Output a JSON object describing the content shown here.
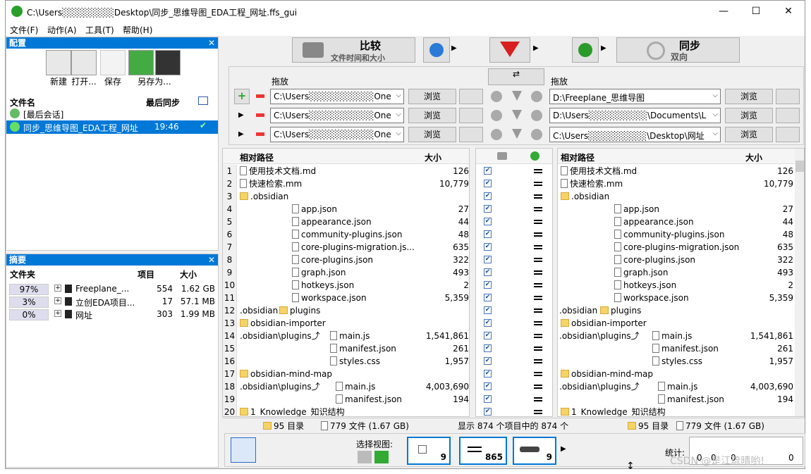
{
  "window": {
    "title": "C:\\Users░░░░░░░░Desktop\\同步_思维导图_EDA工程_网址.ffs_gui"
  },
  "menu": [
    "文件(F)",
    "动作(A)",
    "工具(T)",
    "帮助(H)"
  ],
  "config_panel": {
    "title": "配置",
    "buttons": [
      "新建",
      "打开...",
      "保存",
      "另存为..."
    ],
    "col_file": "文件名",
    "col_last": "最后同步",
    "rows": [
      {
        "name": "[最后会话]",
        "time": ""
      },
      {
        "name": "同步_思维导图_EDA工程_网址",
        "time": "19:46"
      }
    ]
  },
  "summary_panel": {
    "title": "摘要",
    "col_folder": "文件夹",
    "col_items": "项目",
    "col_size": "大小",
    "rows": [
      {
        "pct": "97%",
        "name": "Freeplane_...",
        "items": "554",
        "size": "1.62 GB"
      },
      {
        "pct": "3%",
        "name": "立创EDA项目...",
        "items": "17",
        "size": "57.1 MB"
      },
      {
        "pct": "0%",
        "name": "网址",
        "items": "303",
        "size": "1.99 MB"
      }
    ]
  },
  "toolbar": {
    "compare": "比较",
    "compare_sub": "文件时间和大小",
    "sync": "同步",
    "sync_sub": "双向"
  },
  "left": {
    "drag_label": "拖放",
    "browse": "浏览",
    "paths": [
      "C:\\Users░░░░░░░░░░One",
      "C:\\Users░░░░░░░░░░One",
      "C:\\Users░░░░░░░░░░One"
    ]
  },
  "right": {
    "drag_label": "拖放",
    "browse": "浏览",
    "paths": [
      "D:\\Freeplane_思维导图",
      "D:\\Users░░░░░░░░░\\Documents\\L",
      "C:\\Users░░░░░░░░░\\Desktop\\网址"
    ]
  },
  "grid": {
    "col_path": "相对路径",
    "col_size": "大小",
    "rows": [
      {
        "n": "1",
        "pre": "",
        "ind": 0,
        "type": "file",
        "name": "使用技术文档.md",
        "size": "126",
        "rpre": "",
        "rind": 0
      },
      {
        "n": "2",
        "pre": "",
        "ind": 0,
        "type": "file",
        "name": "快速检索.mm",
        "size": "10,779",
        "rpre": "",
        "rind": 0
      },
      {
        "n": "3",
        "pre": "",
        "ind": 0,
        "type": "folder",
        "name": ".obsidian",
        "size": "",
        "rpre": "",
        "rind": 0
      },
      {
        "n": "4",
        "pre": "",
        "ind": 1,
        "type": "file",
        "name": "app.json",
        "size": "27",
        "rpre": "",
        "rind": 1
      },
      {
        "n": "5",
        "pre": "",
        "ind": 1,
        "type": "file",
        "name": "appearance.json",
        "size": "44",
        "rpre": "",
        "rind": 1
      },
      {
        "n": "6",
        "pre": "",
        "ind": 1,
        "type": "file",
        "name": "community-plugins.json",
        "size": "48",
        "rpre": "",
        "rind": 1
      },
      {
        "n": "7",
        "pre": "",
        "ind": 1,
        "type": "file",
        "name": "core-plugins-migration.js...",
        "rname": "core-plugins-migration.json",
        "size": "635",
        "rpre": "",
        "rind": 1
      },
      {
        "n": "8",
        "pre": "",
        "ind": 1,
        "type": "file",
        "name": "core-plugins.json",
        "size": "322",
        "rpre": "",
        "rind": 1
      },
      {
        "n": "9",
        "pre": "",
        "ind": 1,
        "type": "file",
        "name": "graph.json",
        "size": "493",
        "rpre": "",
        "rind": 1
      },
      {
        "n": "10",
        "pre": "",
        "ind": 1,
        "type": "file",
        "name": "hotkeys.json",
        "size": "2",
        "rpre": "",
        "rind": 1
      },
      {
        "n": "11",
        "pre": "",
        "ind": 1,
        "type": "file",
        "name": "workspace.json",
        "size": "5,359",
        "rpre": "",
        "rind": 1
      },
      {
        "n": "12",
        "pre": ".obsidian",
        "ind": 2,
        "type": "folder",
        "name": "plugins",
        "size": "",
        "rpre": ".obsidian",
        "rind": 2
      },
      {
        "n": "13",
        "pre": "",
        "ind": 0,
        "type": "folder",
        "name": "obsidian-importer",
        "size": "",
        "rpre": "",
        "rind": 0
      },
      {
        "n": "14",
        "pre": ".obsidian\\plugins⤴",
        "ind": 3,
        "type": "file",
        "name": "main.js",
        "size": "1,541,861",
        "rpre": ".obsidian\\plugins⤴",
        "rind": 3
      },
      {
        "n": "15",
        "pre": "",
        "ind": 3,
        "type": "file",
        "name": "manifest.json",
        "size": "261",
        "rpre": "",
        "rind": 3
      },
      {
        "n": "16",
        "pre": "",
        "ind": 3,
        "type": "file",
        "name": "styles.css",
        "size": "1,957",
        "rpre": "",
        "rind": 3
      },
      {
        "n": "17",
        "pre": "",
        "ind": 0,
        "type": "folder",
        "name": "obsidian-mind-map",
        "size": "",
        "rpre": "",
        "rind": 0
      },
      {
        "n": "18",
        "pre": ".obsidian\\plugins⤴",
        "ind": 4,
        "type": "file",
        "name": "main.js",
        "size": "4,003,690",
        "rpre": ".obsidian\\plugins⤴",
        "rind": 4
      },
      {
        "n": "19",
        "pre": "",
        "ind": 4,
        "type": "file",
        "name": "manifest.json",
        "size": "194",
        "rpre": "",
        "rind": 4
      },
      {
        "n": "20",
        "pre": "",
        "ind": 0,
        "type": "folder",
        "name": "1_Knowledge_知识结构",
        "size": "",
        "rpre": "",
        "rind": 0
      }
    ]
  },
  "status": {
    "left_dirs": "95 目录",
    "left_files": "779 文件 (1.67 GB)",
    "middle": "显示 874 个项目中的 874 个",
    "right_dirs": "95 目录",
    "right_files": "779 文件 (1.67 GB)"
  },
  "bottom": {
    "select_view": "选择视图:",
    "count_a": "9",
    "count_b": "865",
    "count_c": "9",
    "stats": "统计:",
    "stat_nums": [
      "0",
      "0",
      "0",
      "0"
    ]
  },
  "watermark": "CSDN @是江琉晴哟!"
}
